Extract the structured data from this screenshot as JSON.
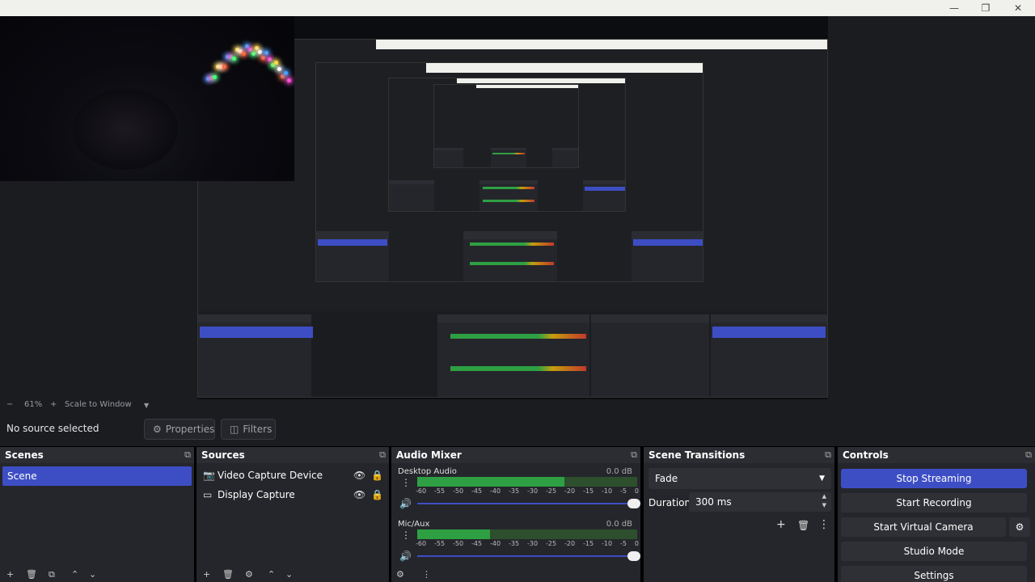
{
  "window": {
    "min_label": "—",
    "max_label": "❐",
    "close_label": "✕"
  },
  "preview": {
    "nested_scene_count": 4
  },
  "zoom_bar": {
    "minus": "−",
    "zoom": "61%",
    "plus": "+",
    "scale_mode": "Scale to Window",
    "dropdown": "▼"
  },
  "source_bar": {
    "status": "No source selected",
    "properties_label": "Properties",
    "filters_label": "Filters"
  },
  "scenes": {
    "title": "Scenes",
    "items": [
      "Scene"
    ],
    "footer": [
      "+",
      "🗑",
      "⧉",
      "⌃",
      "⌄"
    ]
  },
  "sources": {
    "title": "Sources",
    "items": [
      {
        "name": "Video Capture Device",
        "icon": "camera-icon"
      },
      {
        "name": "Display Capture",
        "icon": "monitor-icon"
      }
    ],
    "footer": [
      "+",
      "🗑",
      "⚙",
      "⌃",
      "⌄"
    ]
  },
  "audio_mixer": {
    "title": "Audio Mixer",
    "channels": [
      {
        "name": "Desktop Audio",
        "db": "0.0 dB",
        "level_fraction": 0.67,
        "volume_fraction": 1.0
      },
      {
        "name": "Mic/Aux",
        "db": "0.0 dB",
        "level_fraction": 0.33,
        "volume_fraction": 1.0
      }
    ],
    "ticks": [
      "-60",
      "-55",
      "-50",
      "-45",
      "-40",
      "-35",
      "-30",
      "-25",
      "-20",
      "-15",
      "-10",
      "-5",
      "0"
    ],
    "footer": [
      "⚙",
      "⋮"
    ]
  },
  "scene_transitions": {
    "title": "Scene Transitions",
    "transition": "Fade",
    "duration_label": "Duration",
    "duration_value": "300 ms"
  },
  "controls": {
    "title": "Controls",
    "buttons": [
      "Stop Streaming",
      "Start Recording",
      "Start Virtual Camera",
      "Studio Mode",
      "Settings"
    ]
  },
  "colors": {
    "accent": "#3d4ec5",
    "panel": "#25262b",
    "header": "#2c2d33",
    "meter_green": "#2ea043",
    "meter_yellow": "#c59e0d",
    "meter_red": "#c0392b"
  }
}
